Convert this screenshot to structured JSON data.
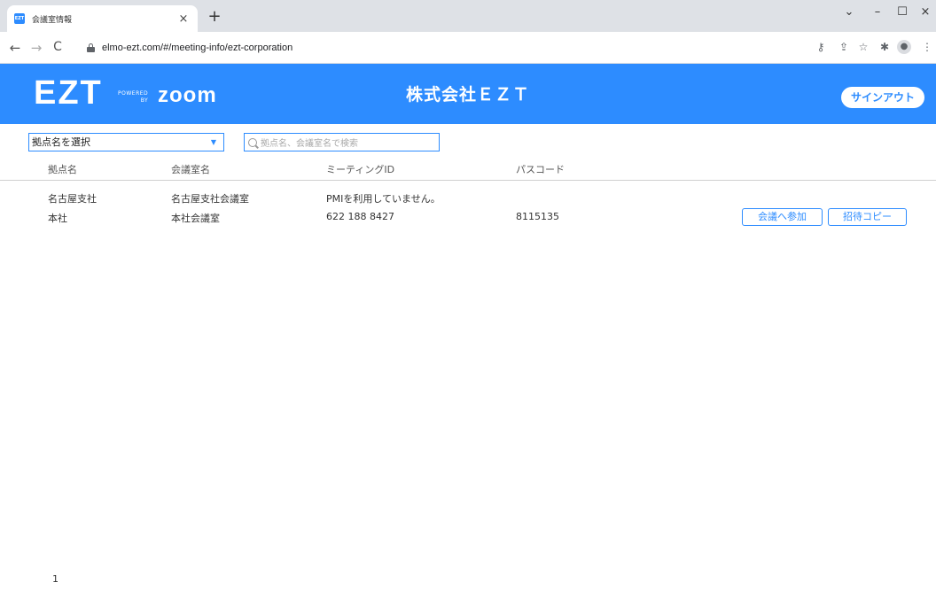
{
  "browser": {
    "tab_title": "会議室情報",
    "favicon_text": "EZT",
    "url": "elmo-ezt.com/#/meeting-info/ezt-corporation"
  },
  "header": {
    "logo": "EZT",
    "powered_line1": "POWERED",
    "powered_line2": "BY",
    "zoom": "zoom",
    "company": "株式会社ＥＺＴ",
    "signout_label": "サインアウト"
  },
  "filters": {
    "select_value": "拠点名を選択",
    "search_placeholder": "拠点名、会議室名で検索"
  },
  "table": {
    "columns": [
      "拠点名",
      "会議室名",
      "ミーティングID",
      "パスコード"
    ],
    "rows": [
      {
        "site": "名古屋支社",
        "room": "名古屋支社会議室",
        "meeting_id": "PMIを利用していません。",
        "passcode": ""
      },
      {
        "site": "本社",
        "room": "本社会議室",
        "meeting_id": "622 188 8427",
        "passcode": "8115135",
        "join_label": "会議へ参加",
        "copy_label": "招待コピー"
      }
    ]
  },
  "pagination": {
    "current": "1"
  },
  "colors": {
    "accent": "#2d8cff"
  }
}
